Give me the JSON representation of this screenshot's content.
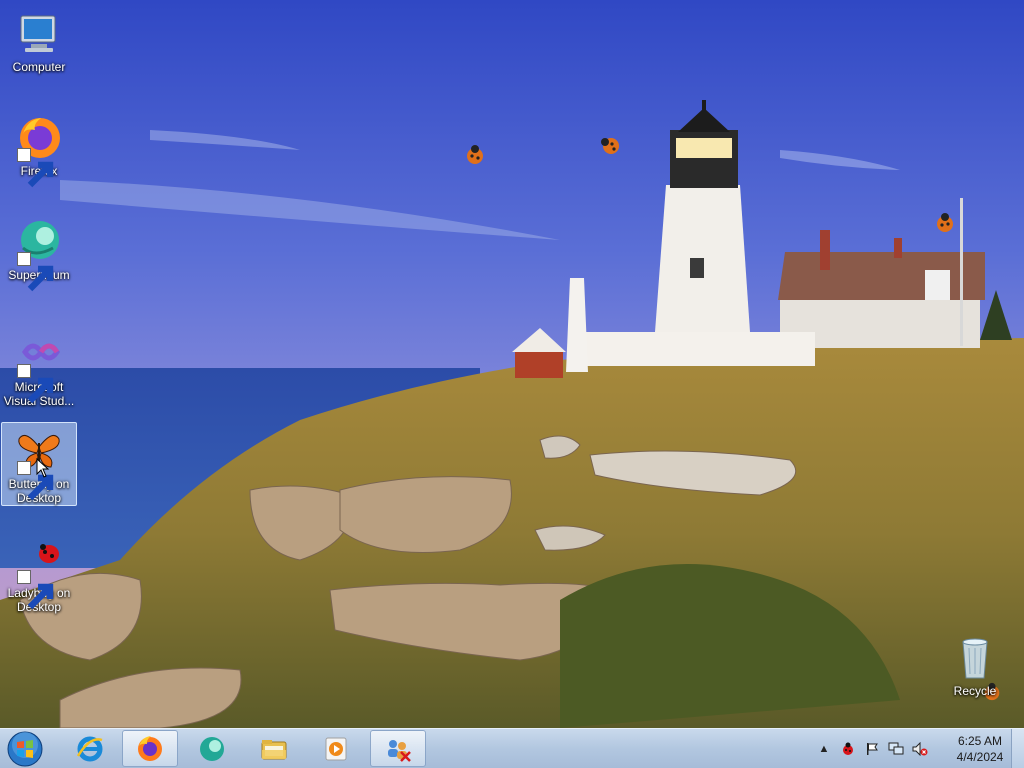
{
  "desktop": {
    "icons": [
      {
        "label": "Computer",
        "icon": "computer-icon"
      },
      {
        "label": "Firefox",
        "icon": "firefox-icon"
      },
      {
        "label": "Supermium",
        "icon": "supermium-icon"
      },
      {
        "label": "Microsoft Visual Stud...",
        "icon": "visual-studio-icon"
      },
      {
        "label": "Butterfly on Desktop",
        "icon": "butterfly-icon",
        "selected": true
      },
      {
        "label": "Ladybug on Desktop",
        "icon": "ladybug-icon"
      },
      {
        "label": "Recycle",
        "icon": "recycle-bin-icon"
      }
    ]
  },
  "taskbar": {
    "start": {
      "icon": "windows-start-icon"
    },
    "pinned": [
      {
        "name": "Internet Explorer",
        "icon": "internet-explorer-icon",
        "active": false
      },
      {
        "name": "Firefox",
        "icon": "firefox-icon",
        "active": true
      },
      {
        "name": "Supermium",
        "icon": "supermium-icon",
        "active": false
      },
      {
        "name": "Windows Explorer",
        "icon": "folder-icon",
        "active": false
      },
      {
        "name": "Windows Media Player",
        "icon": "media-player-icon",
        "active": false
      },
      {
        "name": "Ladybug",
        "icon": "network-users-icon",
        "active": true
      }
    ],
    "tray": {
      "icons": [
        "show-hidden-icons-arrow",
        "ladybug-tray-icon",
        "action-center-flag-icon",
        "network-icon",
        "volume-muted-icon"
      ],
      "time": "6:25 AM",
      "date": "4/4/2024"
    }
  },
  "colors": {
    "sky_top": "#3f57c8",
    "sea": "#2f53a8",
    "taskbar": "#b8cce4",
    "selection": "#c8dcf5"
  }
}
